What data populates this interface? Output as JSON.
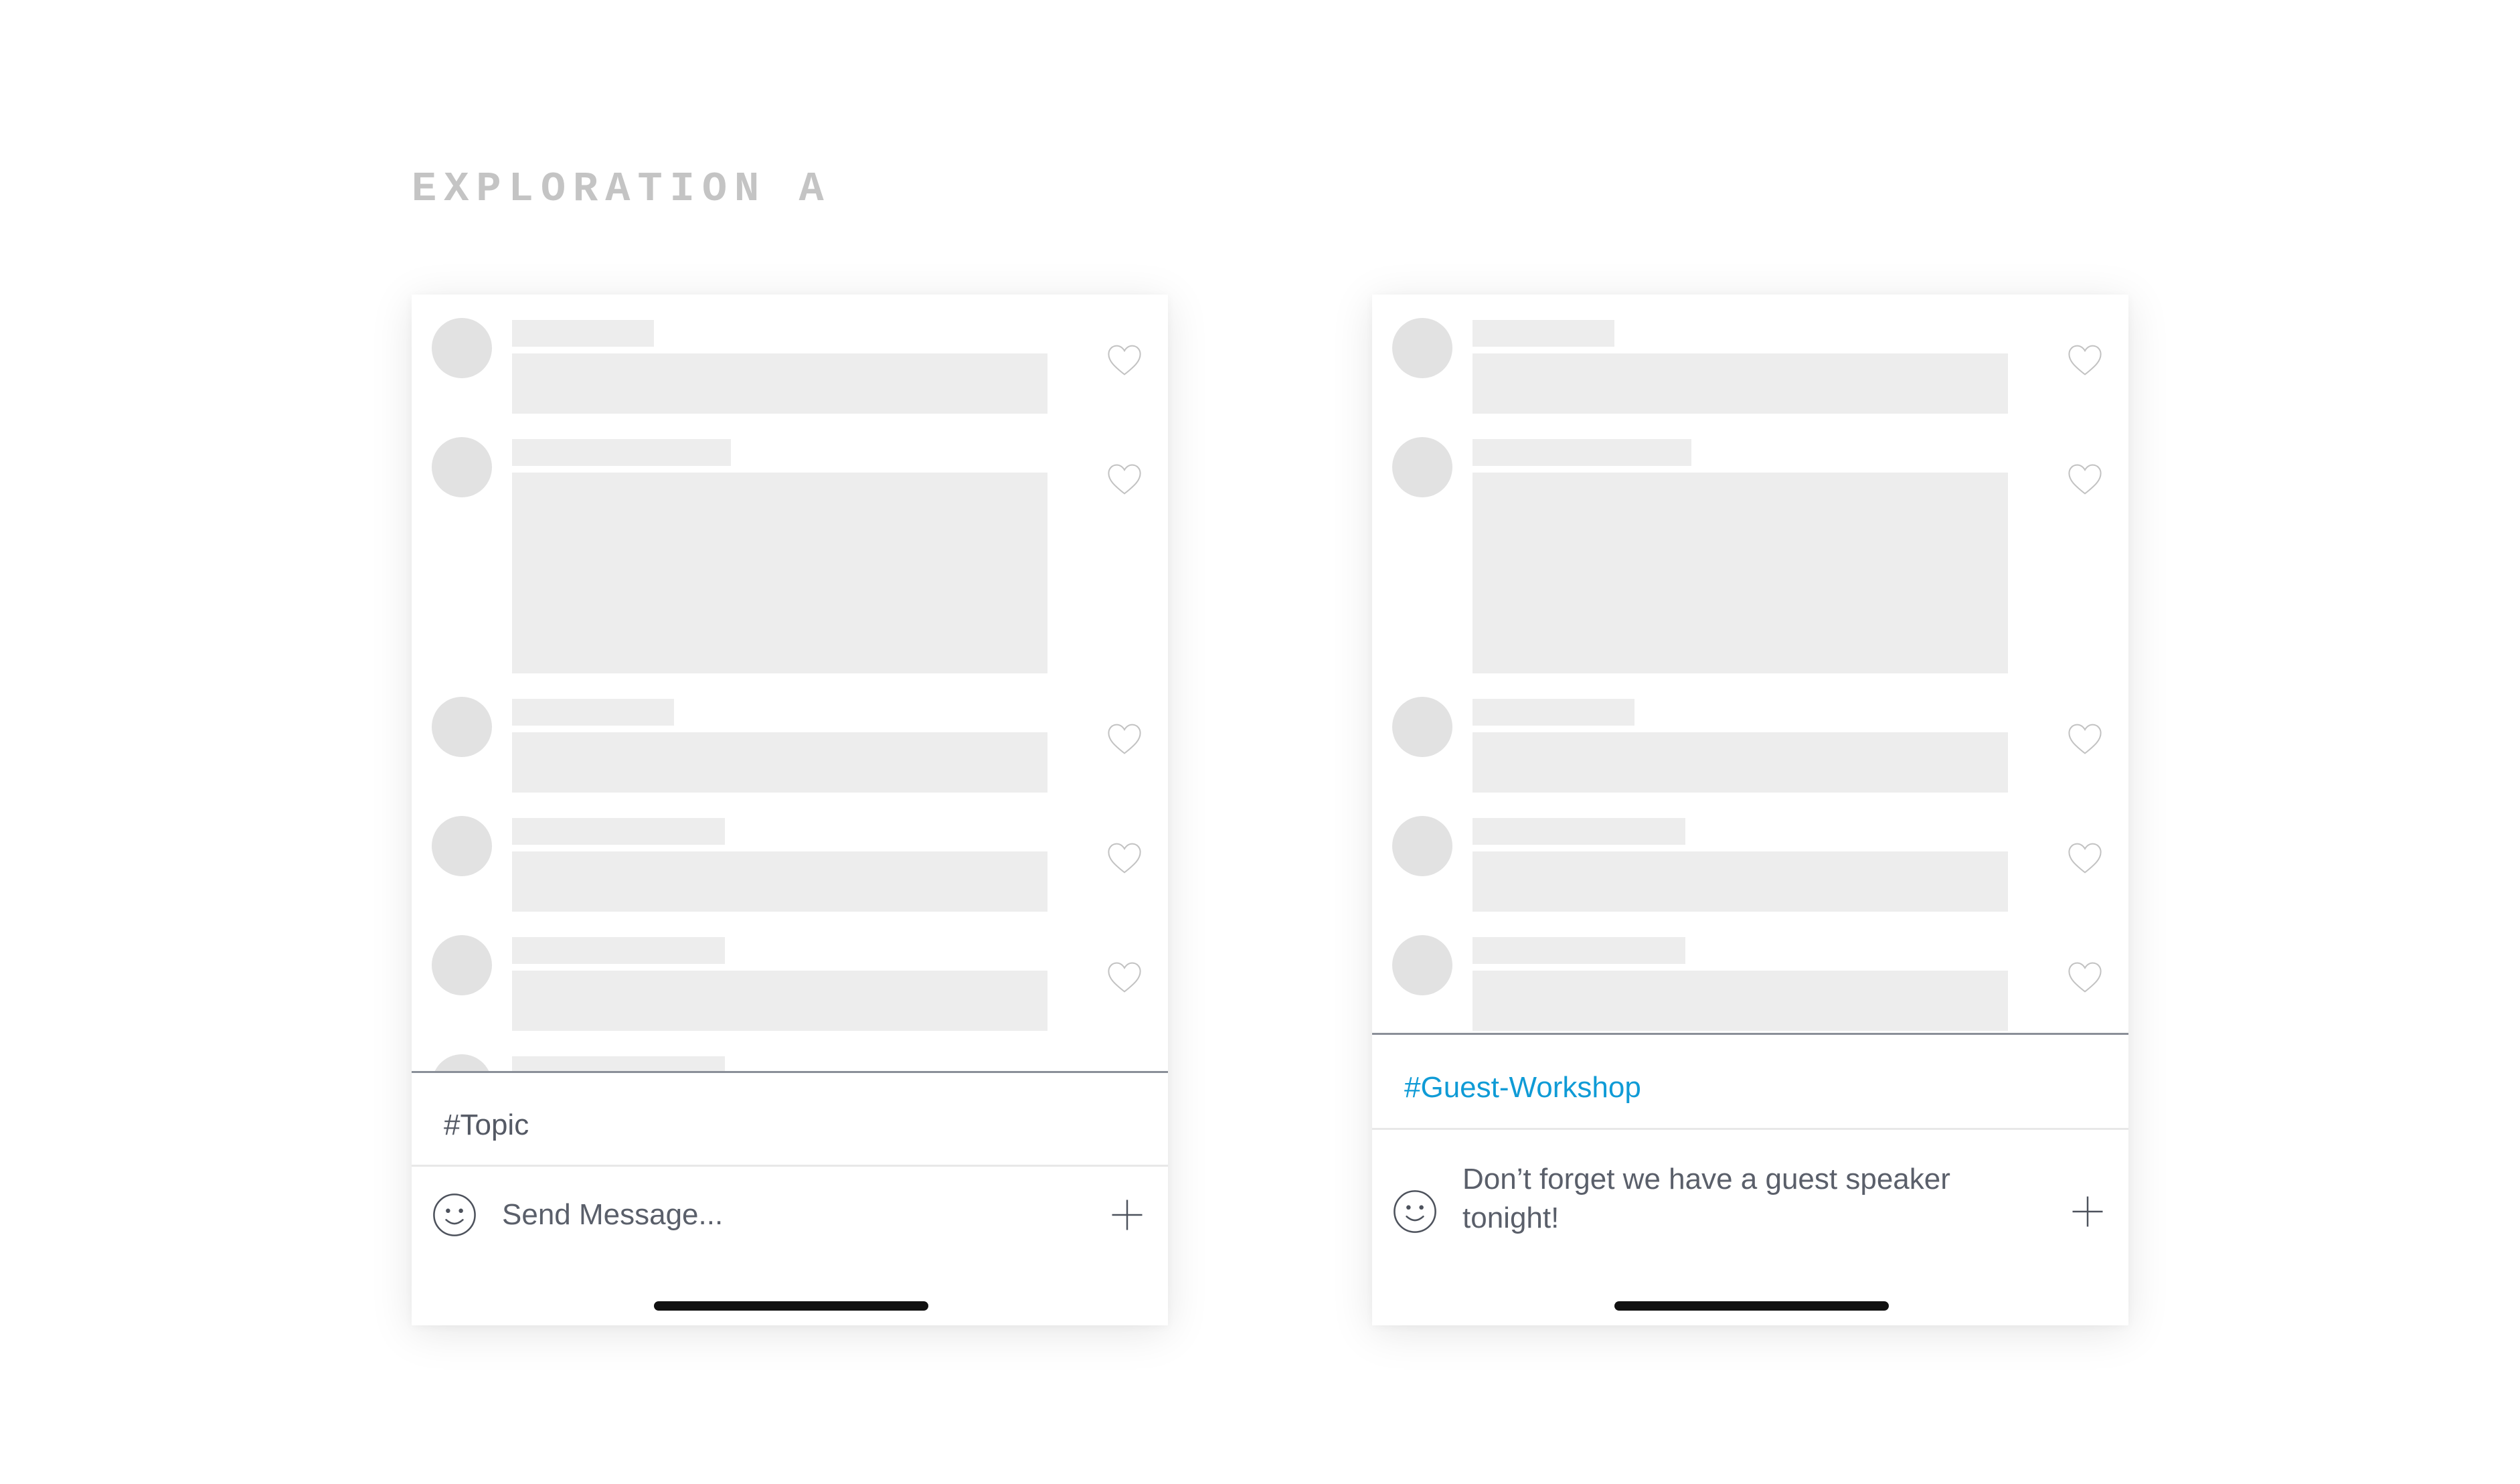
{
  "heading": "EXPLORATION A",
  "screens": [
    {
      "topic": "#Topic",
      "composer_text": "Send Message...",
      "composer_is_placeholder": true
    },
    {
      "topic": "#Guest-Workshop",
      "composer_text": "Don’t forget we have a guest speaker tonight!",
      "composer_is_placeholder": false
    }
  ],
  "icons": {
    "like": "heart-outline-icon",
    "emoji": "smiley-face-icon",
    "attach": "plus-icon"
  },
  "colors": {
    "heading": "#c4c4c4",
    "skeleton": "#ededed",
    "avatar": "#e2e2e2",
    "topic_active": "#0f9bd6",
    "text": "#545964"
  }
}
